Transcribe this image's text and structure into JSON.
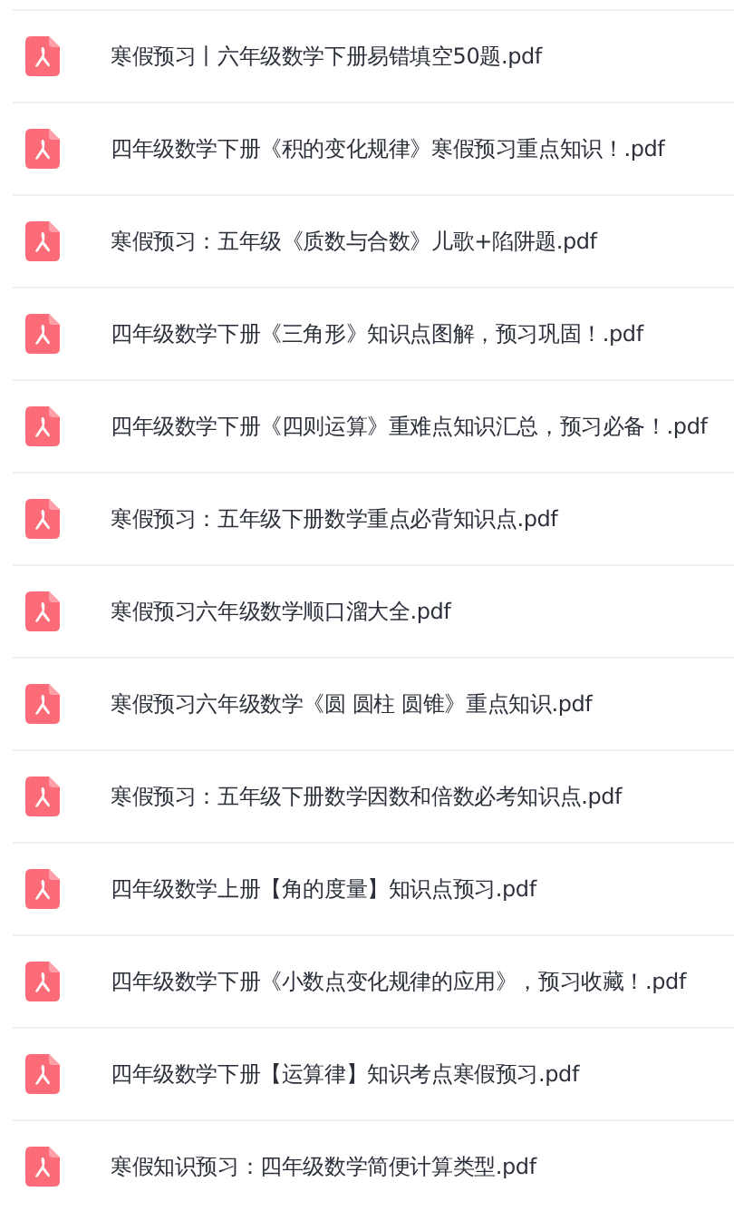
{
  "files": [
    {
      "name": "寒假预习丨六年级数学下册易错填空50题.pdf"
    },
    {
      "name": "四年级数学下册《积的变化规律》寒假预习重点知识！.pdf"
    },
    {
      "name": "寒假预习：五年级《质数与合数》儿歌+陷阱题.pdf"
    },
    {
      "name": "四年级数学下册《三角形》知识点图解，预习巩固！.pdf"
    },
    {
      "name": "四年级数学下册《四则运算》重难点知识汇总，预习必备！.pdf"
    },
    {
      "name": "寒假预习：五年级下册数学重点必背知识点.pdf"
    },
    {
      "name": "寒假预习六年级数学顺口溜大全.pdf"
    },
    {
      "name": "寒假预习六年级数学《圆 圆柱 圆锥》重点知识.pdf"
    },
    {
      "name": "寒假预习：五年级下册数学因数和倍数必考知识点.pdf"
    },
    {
      "name": "四年级数学上册【角的度量】知识点预习.pdf"
    },
    {
      "name": "四年级数学下册《小数点变化规律的应用》，预习收藏！.pdf"
    },
    {
      "name": "四年级数学下册【运算律】知识考点寒假预习.pdf"
    },
    {
      "name": "寒假知识预习：四年级数学简便计算类型.pdf"
    }
  ]
}
